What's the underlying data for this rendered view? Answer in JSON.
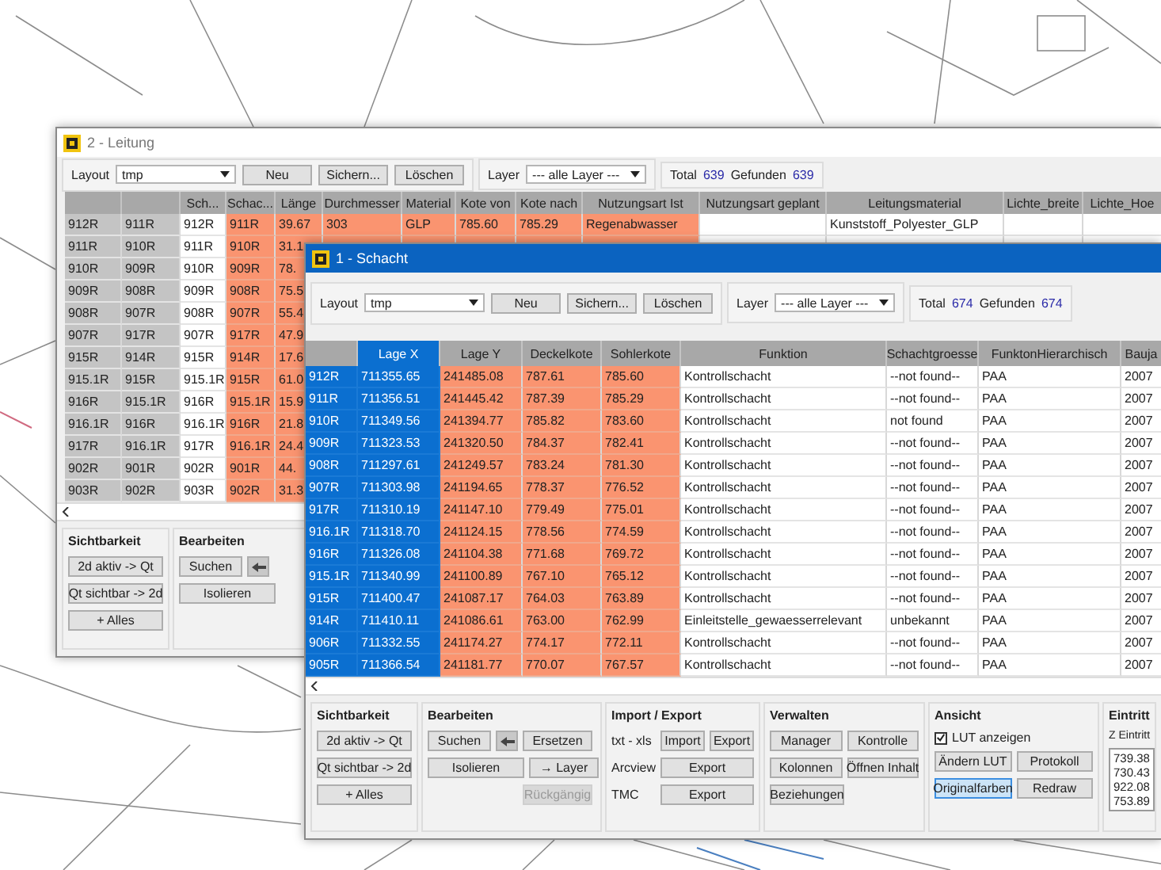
{
  "windows": [
    {
      "title": "2 - Leitung",
      "active": false,
      "toolbar": {
        "layout_label": "Layout",
        "layout_value": "tmp",
        "buttons": [
          "Neu",
          "Sichern...",
          "Löschen"
        ],
        "layer_label": "Layer",
        "layer_value": "--- alle Layer ---",
        "total_label": "Total",
        "total": "639",
        "found_label": "Gefunden",
        "found": "639"
      },
      "table": {
        "columns": [
          {
            "kind": "rowhead",
            "selected": false
          },
          {
            "kind": "rowhead",
            "selected": false
          },
          {
            "label": "Sch...",
            "kind": "plain",
            "selected": false
          },
          {
            "label": "Schac...",
            "kind": "orange",
            "selected": false
          },
          {
            "label": "Länge",
            "kind": "orange",
            "selected": false
          },
          {
            "label": "Durchmesser",
            "kind": "orange",
            "selected": false
          },
          {
            "label": "Material",
            "kind": "orange",
            "selected": false
          },
          {
            "label": "Kote von",
            "kind": "orange",
            "selected": false
          },
          {
            "label": "Kote nach",
            "kind": "orange",
            "selected": false
          },
          {
            "label": "Nutzungsart Ist",
            "kind": "orange",
            "selected": false
          },
          {
            "label": "Nutzungsart geplant",
            "kind": "plain",
            "selected": false
          },
          {
            "label": "Leitungsmaterial",
            "kind": "plain",
            "selected": false
          },
          {
            "label": "Lichte_breite",
            "kind": "plain",
            "selected": false
          },
          {
            "label": "Lichte_Hoe",
            "kind": "plain",
            "selected": false
          }
        ],
        "rows": [
          {
            "selected": false,
            "cells": [
              "912R",
              "911R",
              "912R",
              "911R",
              "39.67",
              "303",
              "GLP",
              "785.60",
              "785.29",
              "Regenabwasser",
              null,
              "Kunststoff_Polyester_GLP"
            ]
          },
          {
            "selected": false,
            "cells": [
              "911R",
              "910R",
              "911R",
              "910R",
              "31.1"
            ]
          },
          {
            "selected": false,
            "cells": [
              "910R",
              "909R",
              "910R",
              "909R",
              "78."
            ]
          },
          {
            "selected": false,
            "cells": [
              "909R",
              "908R",
              "909R",
              "908R",
              "75.5"
            ]
          },
          {
            "selected": false,
            "cells": [
              "908R",
              "907R",
              "908R",
              "907R",
              "55.4"
            ]
          },
          {
            "selected": false,
            "cells": [
              "907R",
              "917R",
              "907R",
              "917R",
              "47.9"
            ]
          },
          {
            "selected": false,
            "cells": [
              "915R",
              "914R",
              "915R",
              "914R",
              "17.6"
            ]
          },
          {
            "selected": false,
            "cells": [
              "915.1R",
              "915R",
              "915.1R",
              "915R",
              "61.0"
            ]
          },
          {
            "selected": false,
            "cells": [
              "916R",
              "915.1R",
              "916R",
              "915.1R",
              "15.9"
            ]
          },
          {
            "selected": false,
            "cells": [
              "916.1R",
              "916R",
              "916.1R",
              "916R",
              "21.8"
            ]
          },
          {
            "selected": false,
            "cells": [
              "917R",
              "916.1R",
              "917R",
              "916.1R",
              "24.4"
            ]
          },
          {
            "selected": false,
            "cells": [
              "902R",
              "901R",
              "902R",
              "901R",
              "44."
            ]
          },
          {
            "selected": false,
            "cells": [
              "903R",
              "902R",
              "903R",
              "902R",
              "31.3"
            ]
          }
        ]
      },
      "panels": [
        {
          "title": "Sichtbarkeit",
          "rows": [
            [
              {
                "kind": "button",
                "label": "2d aktiv -> Qt"
              }
            ],
            [
              {
                "kind": "button",
                "label": "Qt sichtbar -> 2d"
              }
            ],
            [
              {
                "kind": "button",
                "label": "+ Alles"
              }
            ]
          ]
        },
        {
          "title": "Bearbeiten",
          "rows": [
            [
              {
                "kind": "button",
                "label": "Suchen"
              },
              {
                "kind": "arrow-button"
              }
            ],
            [
              {
                "kind": "button",
                "label": "Isolieren"
              }
            ]
          ]
        }
      ]
    },
    {
      "title": "1 - Schacht",
      "active": true,
      "toolbar": {
        "layout_label": "Layout",
        "layout_value": "tmp",
        "buttons": [
          "Neu",
          "Sichern...",
          "Löschen"
        ],
        "layer_label": "Layer",
        "layer_value": "--- alle Layer ---",
        "total_label": "Total",
        "total": "674",
        "found_label": "Gefunden",
        "found": "674"
      },
      "table": {
        "columns": [
          {
            "kind": "rowhead",
            "selected": false
          },
          {
            "label": "Lage X",
            "kind": "plain",
            "selected": true
          },
          {
            "label": "Lage Y",
            "kind": "orange",
            "selected": false
          },
          {
            "label": "Deckelkote",
            "kind": "orange",
            "selected": false
          },
          {
            "label": "Sohlerkote",
            "kind": "orange",
            "selected": false
          },
          {
            "label": "Funktion",
            "kind": "plain",
            "selected": false
          },
          {
            "label": "Schachtgroesse",
            "kind": "plain",
            "selected": false
          },
          {
            "label": "FunktonHierarchisch",
            "kind": "plain",
            "selected": false
          },
          {
            "label": "Bauja",
            "kind": "plain",
            "selected": false
          }
        ],
        "rows": [
          {
            "selected": true,
            "cells": [
              "912R",
              "711355.65",
              "241485.08",
              "787.61",
              "785.60",
              "Kontrollschacht",
              "--not found--",
              "PAA",
              "2007"
            ]
          },
          {
            "selected": true,
            "cells": [
              "911R",
              "711356.51",
              "241445.42",
              "787.39",
              "785.29",
              "Kontrollschacht",
              "--not found--",
              "PAA",
              "2007"
            ]
          },
          {
            "selected": true,
            "cells": [
              "910R",
              "711349.56",
              "241394.77",
              "785.82",
              "783.60",
              "Kontrollschacht",
              "not found",
              "PAA",
              "2007"
            ]
          },
          {
            "selected": true,
            "cells": [
              "909R",
              "711323.53",
              "241320.50",
              "784.37",
              "782.41",
              "Kontrollschacht",
              "--not found--",
              "PAA",
              "2007"
            ]
          },
          {
            "selected": true,
            "cells": [
              "908R",
              "711297.61",
              "241249.57",
              "783.24",
              "781.30",
              "Kontrollschacht",
              "--not found--",
              "PAA",
              "2007"
            ]
          },
          {
            "selected": true,
            "cells": [
              "907R",
              "711303.98",
              "241194.65",
              "778.37",
              "776.52",
              "Kontrollschacht",
              "--not found--",
              "PAA",
              "2007"
            ]
          },
          {
            "selected": true,
            "cells": [
              "917R",
              "711310.19",
              "241147.10",
              "779.49",
              "775.01",
              "Kontrollschacht",
              "--not found--",
              "PAA",
              "2007"
            ]
          },
          {
            "selected": true,
            "cells": [
              "916.1R",
              "711318.70",
              "241124.15",
              "778.56",
              "774.59",
              "Kontrollschacht",
              "--not found--",
              "PAA",
              "2007"
            ]
          },
          {
            "selected": true,
            "cells": [
              "916R",
              "711326.08",
              "241104.38",
              "771.68",
              "769.72",
              "Kontrollschacht",
              "--not found--",
              "PAA",
              "2007"
            ]
          },
          {
            "selected": true,
            "cells": [
              "915.1R",
              "711340.99",
              "241100.89",
              "767.10",
              "765.12",
              "Kontrollschacht",
              "--not found--",
              "PAA",
              "2007"
            ]
          },
          {
            "selected": true,
            "cells": [
              "915R",
              "711400.47",
              "241087.17",
              "764.03",
              "763.89",
              "Kontrollschacht",
              "--not found--",
              "PAA",
              "2007"
            ]
          },
          {
            "selected": true,
            "cells": [
              "914R",
              "711410.11",
              "241086.61",
              "763.00",
              "762.99",
              "Einleitstelle_gewaesserrelevant",
              "unbekannt",
              "PAA",
              "2007"
            ]
          },
          {
            "selected": true,
            "cells": [
              "906R",
              "711332.55",
              "241174.27",
              "774.17",
              "772.11",
              "Kontrollschacht",
              "--not found--",
              "PAA",
              "2007"
            ]
          },
          {
            "selected": true,
            "cells": [
              "905R",
              "711366.54",
              "241181.77",
              "770.07",
              "767.57",
              "Kontrollschacht",
              "--not found--",
              "PAA",
              "2007"
            ]
          }
        ]
      },
      "panels": [
        {
          "title": "Sichtbarkeit",
          "rows": [
            [
              {
                "kind": "button",
                "label": "2d aktiv -> Qt"
              }
            ],
            [
              {
                "kind": "button",
                "label": "Qt sichtbar -> 2d"
              }
            ],
            [
              {
                "kind": "button",
                "label": "+ Alles"
              }
            ]
          ]
        },
        {
          "title": "Bearbeiten",
          "rows": [
            [
              {
                "kind": "button",
                "label": "Suchen",
                "disabled": false
              },
              {
                "kind": "arrow-button"
              },
              {
                "kind": "button",
                "label": "Ersetzen",
                "disabled": false
              }
            ],
            [
              {
                "kind": "button",
                "label": "Isolieren",
                "disabled": false
              },
              {
                "kind": "button",
                "label": "→ Layer",
                "disabled": false
              }
            ],
            [
              "",
              "",
              {
                "kind": "button",
                "label": "Rückgängig",
                "disabled": true
              }
            ]
          ]
        },
        {
          "title": "Import / Export",
          "rows": [
            [
              {
                "kind": "label",
                "label": "txt - xls"
              },
              {
                "kind": "button",
                "label": "Import"
              },
              {
                "kind": "button",
                "label": "Export"
              }
            ],
            [
              {
                "kind": "label",
                "label": "Arcview"
              },
              {
                "kind": "button",
                "label": "Export"
              }
            ],
            [
              {
                "kind": "label",
                "label": "TMC"
              },
              {
                "kind": "button",
                "label": "Export"
              }
            ]
          ]
        },
        {
          "title": "Verwalten",
          "rows": [
            [
              {
                "kind": "button",
                "label": "Manager"
              },
              {
                "kind": "button",
                "label": "Kontrolle"
              }
            ],
            [
              {
                "kind": "button",
                "label": "Kolonnen"
              },
              {
                "kind": "button",
                "label": "Öffnen Inhalt"
              }
            ],
            [
              {
                "kind": "button",
                "label": "Beziehungen"
              }
            ]
          ]
        },
        {
          "title": "Ansicht",
          "rows": [
            [
              {
                "kind": "checkbox",
                "label": "LUT anzeigen",
                "checked": true
              }
            ],
            [
              {
                "kind": "button",
                "label": "Ändern LUT",
                "selected": false
              },
              {
                "kind": "button",
                "label": "Protokoll",
                "selected": false
              }
            ],
            [
              {
                "kind": "button",
                "label": "Originalfarben",
                "selected": true
              },
              {
                "kind": "button",
                "label": "Redraw",
                "selected": false
              }
            ]
          ]
        },
        {
          "title": "Eintritt",
          "rows": [
            [
              {
                "kind": "label",
                "label": "Z Eintritt"
              }
            ],
            [
              {
                "kind": "list",
                "values": [
                  "739.38",
                  "730.43",
                  "922.08",
                  "753.89"
                ]
              }
            ]
          ]
        }
      ]
    }
  ]
}
